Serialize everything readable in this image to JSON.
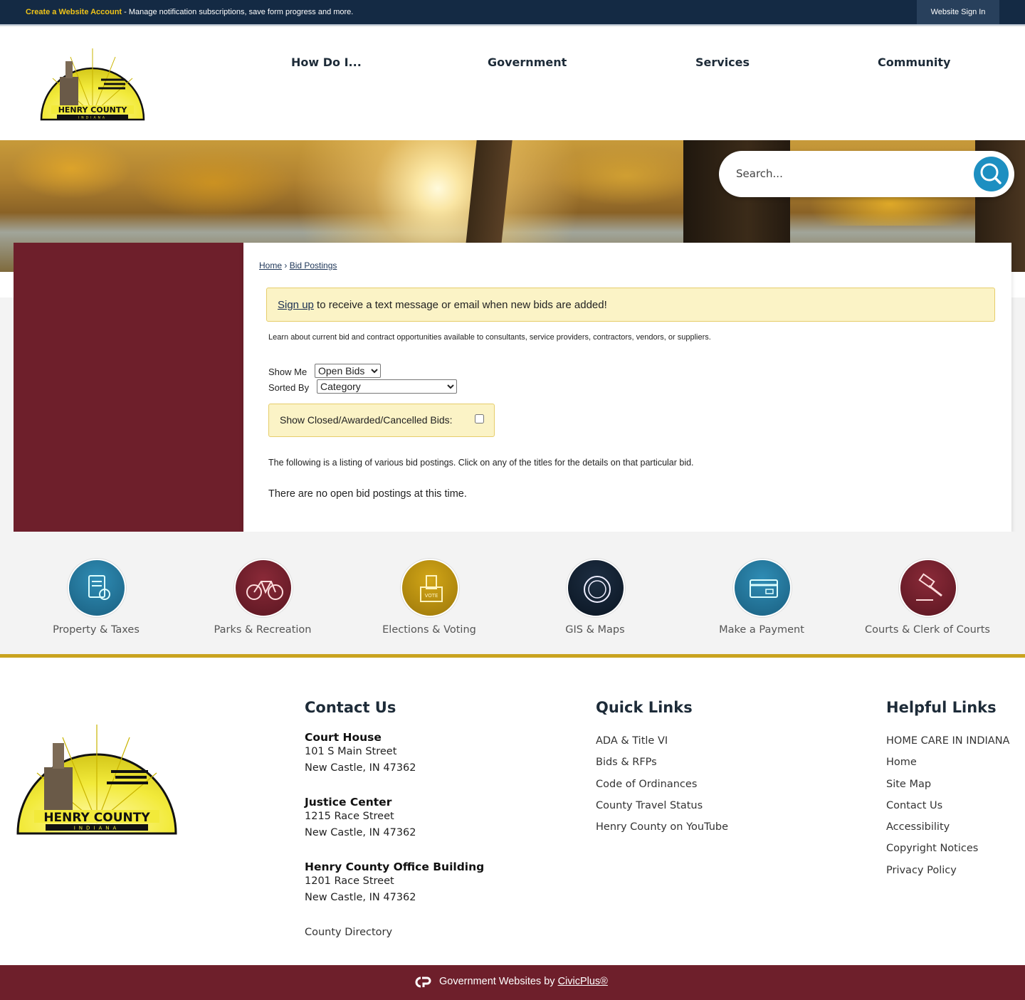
{
  "topbar": {
    "create_link": "Create a Website Account",
    "message": " - Manage notification subscriptions, save form progress and more.",
    "signin": "Website Sign In"
  },
  "header": {
    "logo_text": "HENRY COUNTY",
    "logo_subtext": "INDIANA",
    "nav": [
      "How Do I...",
      "Government",
      "Services",
      "Community"
    ]
  },
  "search": {
    "placeholder": "Search..."
  },
  "breadcrumb": {
    "home": "Home",
    "separator": "›",
    "current": "Bid Postings"
  },
  "alert": {
    "link": "Sign up",
    "text": " to receive a text message or email when new bids are added!"
  },
  "intro": "Learn about current bid and contract opportunities available to consultants, service providers, contractors, vendors, or suppliers.",
  "filters": {
    "show_me_label": "Show Me",
    "show_me_value": "Open Bids",
    "sorted_by_label": "Sorted By",
    "sorted_by_value": "Category",
    "closed_label": "Show Closed/Awarded/Cancelled Bids:"
  },
  "listing_text": "The following is a listing of various bid postings. Click on any of the titles for the details on that particular bid.",
  "no_bids_text": "There are no open bid postings at this time.",
  "quicklinks": [
    {
      "label": "Property & Taxes",
      "icon": "tax-document-icon",
      "color": "#1f6b8e"
    },
    {
      "label": "Parks & Recreation",
      "icon": "bicycle-icon",
      "color": "#6e1f2b"
    },
    {
      "label": "Elections & Voting",
      "icon": "ballot-box-icon",
      "color": "#b08a10"
    },
    {
      "label": "GIS & Maps",
      "icon": "compass-icon",
      "color": "#0f1c2b"
    },
    {
      "label": "Make a Payment",
      "icon": "credit-card-icon",
      "color": "#1f6b8e"
    },
    {
      "label": "Courts & Clerk of Courts",
      "icon": "gavel-icon",
      "color": "#6e1f2b"
    }
  ],
  "footer": {
    "contact": {
      "heading": "Contact Us",
      "locations": [
        {
          "name": "Court House",
          "line1": "101 S Main Street",
          "line2": "New Castle, IN 47362"
        },
        {
          "name": "Justice Center",
          "line1": "1215 Race Street",
          "line2": "New Castle, IN 47362"
        },
        {
          "name": "Henry County Office Building",
          "line1": "1201 Race Street",
          "line2": "New Castle, IN 47362"
        }
      ],
      "directory": "County Directory"
    },
    "quick_links": {
      "heading": "Quick Links",
      "items": [
        "ADA & Title VI",
        "Bids & RFPs",
        "Code of Ordinances",
        "County Travel Status",
        "Henry County on YouTube"
      ]
    },
    "helpful_links": {
      "heading": "Helpful Links",
      "items": [
        "HOME CARE IN INDIANA",
        "Home",
        "Site Map",
        "Contact Us",
        "Accessibility",
        "Copyright Notices",
        "Privacy Policy"
      ]
    }
  },
  "bottombar": {
    "text": "Government Websites by ",
    "link": "CivicPlus®"
  },
  "colors": {
    "maroon": "#6e1f2b",
    "navy": "#142a44",
    "gold": "#c9a31f",
    "search_blue": "#1d8fc1",
    "alert_yellow": "#fbf3c6"
  }
}
